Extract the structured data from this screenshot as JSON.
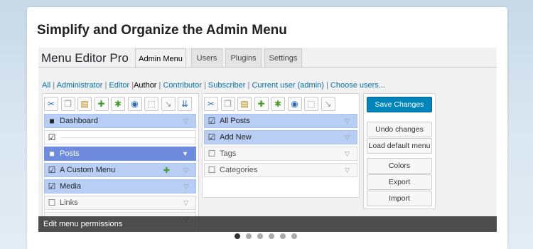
{
  "headline": "Simplify and Organize the Admin Menu",
  "app_title": "Menu Editor Pro",
  "tabs": [
    "Admin Menu",
    "Users",
    "Plugins",
    "Settings"
  ],
  "active_tab": "Admin Menu",
  "filters": [
    "All",
    "Administrator",
    "Editor",
    "Author",
    "Contributor",
    "Subscriber",
    "Current user (admin)",
    "Choose users..."
  ],
  "current_filter": "Author",
  "toolbar_icons": [
    "cut-icon",
    "copy-icon",
    "paste-icon",
    "new-item-icon",
    "new-separator-icon",
    "hide-icon",
    "select-all-icon",
    "new-submenu-icon",
    "expand-icon"
  ],
  "left_menu": [
    {
      "label": "Dashboard",
      "check": "■",
      "arrow": "▽"
    },
    {
      "label": "",
      "check": "☑",
      "arrow": ""
    },
    {
      "label": "Posts",
      "check": "■",
      "arrow": "▼"
    },
    {
      "label": "A Custom Menu",
      "check": "☑",
      "arrow": "▽"
    },
    {
      "label": "Media",
      "check": "☑",
      "arrow": "▽"
    },
    {
      "label": "Links",
      "check": "☐",
      "arrow": "▽"
    },
    {
      "label": "",
      "check": "",
      "arrow": "▽"
    }
  ],
  "right_menu": [
    {
      "label": "All Posts",
      "check": "☑",
      "arrow": "▽"
    },
    {
      "label": "Add New",
      "check": "☑",
      "arrow": "▽"
    },
    {
      "label": "Tags",
      "check": "☐",
      "arrow": "▽"
    },
    {
      "label": "Categories",
      "check": "☐",
      "arrow": "▽"
    }
  ],
  "buttons": {
    "save": "Save Changes",
    "undo": "Undo changes",
    "load_default": "Load default menu",
    "colors": "Colors",
    "export": "Export",
    "import": "Import"
  },
  "caption": "Edit menu permissions",
  "slider": {
    "count": 6,
    "active": 1
  },
  "colors": {
    "accent": "#0085ba",
    "selected_row": "#b9cef5",
    "highlight_row": "#6f8bdd",
    "link": "#0073aa"
  }
}
